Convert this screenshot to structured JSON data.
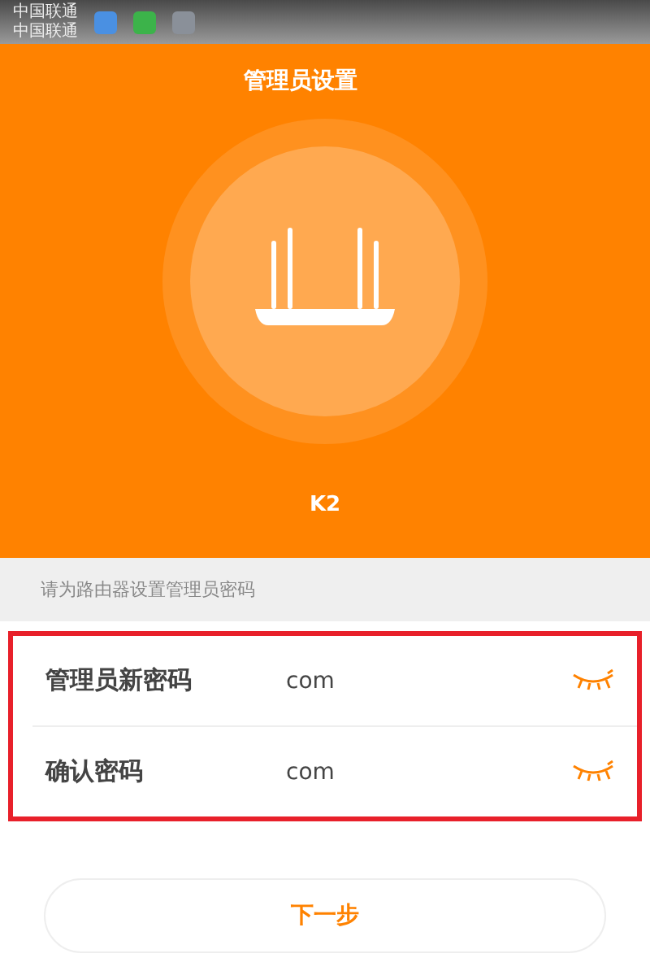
{
  "status_bar": {
    "carriers": [
      "中国联通",
      "中国联通"
    ]
  },
  "header": {
    "title": "管理员设置",
    "device_name": "K2"
  },
  "hint": "请为路由器设置管理员密码",
  "fields": [
    {
      "label": "管理员新密码",
      "value": "com",
      "password_visible": false
    },
    {
      "label": "确认密码",
      "value": "com",
      "password_visible": false
    }
  ],
  "next_button": "下一步"
}
